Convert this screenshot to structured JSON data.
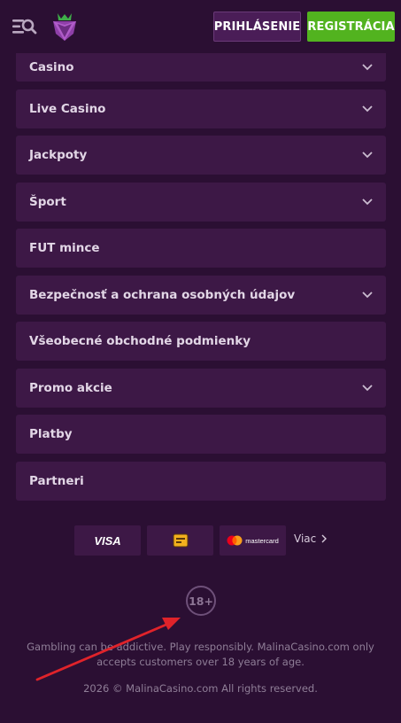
{
  "header": {
    "menu_icon": "menu-search-icon",
    "logo_icon": "raspberry-logo-icon",
    "login_label": "PRIHLÁSENIE",
    "register_label": "REGISTRÁCIA",
    "colors": {
      "login_bg": "#4a1d57",
      "register_bg": "#52b31f"
    }
  },
  "menu": {
    "items": [
      {
        "label": "Casino",
        "expandable": true
      },
      {
        "label": "Live Casino",
        "expandable": true
      },
      {
        "label": "Jackpoty",
        "expandable": true
      },
      {
        "label": "Šport",
        "expandable": true
      },
      {
        "label": "FUT mince",
        "expandable": false
      },
      {
        "label": "Bezpečnosť a ochrana osobných údajov",
        "expandable": true
      },
      {
        "label": "Všeobecné obchodné podmienky",
        "expandable": false
      },
      {
        "label": "Promo akcie",
        "expandable": true
      },
      {
        "label": "Platby",
        "expandable": false
      },
      {
        "label": "Partneri",
        "expandable": false
      }
    ]
  },
  "payments": {
    "visa": "VISA",
    "paysafe_icon": "paysafe-icon",
    "mastercard": "mastercard",
    "more_label": "Viac"
  },
  "footer": {
    "age_badge": "18+",
    "disclaimer": "Gambling can be addictive. Play responsibly. MalinaCasino.com only accepts customers over 18 years of age.",
    "copyright": "2026 © MalinaCasino.com All rights reserved."
  },
  "annotation": {
    "arrow_color": "#e0232a"
  },
  "colors": {
    "background": "#2b0f33",
    "item_bg": "#3d1846"
  }
}
